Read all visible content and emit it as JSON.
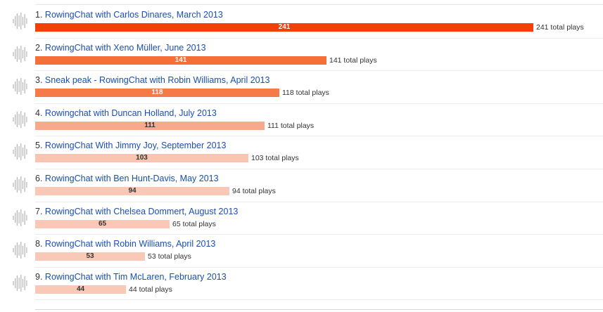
{
  "plays_suffix": "total plays",
  "tracks": [
    {
      "rank": "1.",
      "title": "RowingChat with Carlos Dinares, March 2013",
      "plays": 241,
      "plays_label": "241 total plays",
      "bar_color": "#f43f0a",
      "value_color": "#ffffff"
    },
    {
      "rank": "2.",
      "title": "RowingChat with Xeno Müller, June 2013",
      "plays": 141,
      "plays_label": "141 total plays",
      "bar_color": "#f56f38",
      "value_color": "#ffffff"
    },
    {
      "rank": "3.",
      "title": "Sneak peak - RowingChat with Robin Williams, April 2013",
      "plays": 118,
      "plays_label": "118 total plays",
      "bar_color": "#f57a48",
      "value_color": "#ffffff"
    },
    {
      "rank": "4.",
      "title": "Rowingchat with Duncan Holland, July 2013",
      "plays": 111,
      "plays_label": "111 total plays",
      "bar_color": "#f7a98e",
      "value_color": "#333333"
    },
    {
      "rank": "5.",
      "title": "RowingChat With Jimmy Joy, September 2013",
      "plays": 103,
      "plays_label": "103 total plays",
      "bar_color": "#f9c4b1",
      "value_color": "#333333"
    },
    {
      "rank": "6.",
      "title": "RowingChat with Ben Hunt-Davis, May 2013",
      "plays": 94,
      "plays_label": "94 total plays",
      "bar_color": "#fac8b6",
      "value_color": "#333333"
    },
    {
      "rank": "7.",
      "title": "RowingChat with Chelsea Dommert, August 2013",
      "plays": 65,
      "plays_label": "65 total plays",
      "bar_color": "#fac8b6",
      "value_color": "#333333"
    },
    {
      "rank": "8.",
      "title": "RowingChat with Robin Williams, April 2013",
      "plays": 53,
      "plays_label": "53 total plays",
      "bar_color": "#fac8b6",
      "value_color": "#333333"
    },
    {
      "rank": "9.",
      "title": "RowingChat with Tim McLaren, February 2013",
      "plays": 44,
      "plays_label": "44 total plays",
      "bar_color": "#fac8b6",
      "value_color": "#333333"
    }
  ],
  "icons": {
    "track": "waveform-icon"
  }
}
